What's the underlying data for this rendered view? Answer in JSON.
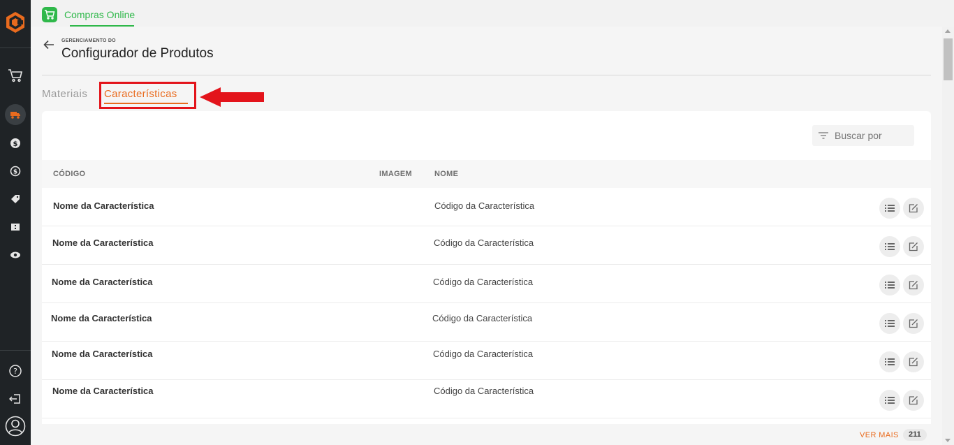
{
  "app": {
    "tab_label": "Compras Online",
    "accent": "#2fb84a",
    "highlight": "#e96b1e"
  },
  "sidebar": {
    "items": [
      {
        "icon": "cart-icon"
      },
      {
        "icon": "truck-icon"
      },
      {
        "icon": "dollar-icon"
      },
      {
        "icon": "exchange-icon"
      },
      {
        "icon": "tag-icon"
      },
      {
        "icon": "ticket-icon"
      },
      {
        "icon": "eye-icon"
      }
    ],
    "bottom": [
      {
        "icon": "help-icon"
      },
      {
        "icon": "logout-icon"
      },
      {
        "icon": "user-avatar-icon"
      }
    ]
  },
  "header": {
    "kicker": "GERENCIAMENTO DO",
    "title": "Configurador de Produtos"
  },
  "tabs": [
    {
      "label": "Materiais",
      "active": false
    },
    {
      "label": "Características",
      "active": true
    }
  ],
  "search": {
    "placeholder": "Buscar por"
  },
  "table": {
    "columns": [
      "CÓDIGO",
      "IMAGEM",
      "NOME"
    ],
    "rows": [
      {
        "name": "Nome da Característica",
        "code": "Código da Característica"
      },
      {
        "name": "Nome da Característica",
        "code": "Código da Característica"
      },
      {
        "name": "Nome da Característica",
        "code": "Código da Característica"
      },
      {
        "name": "Nome da Característica",
        "code": "Código da Característica"
      },
      {
        "name": "Nome da Característica",
        "code": "Código da Característica"
      },
      {
        "name": "Nome da Característica",
        "code": "Código da Característica"
      }
    ]
  },
  "footer": {
    "ver_mais": "VER MAIS",
    "count": "211"
  }
}
